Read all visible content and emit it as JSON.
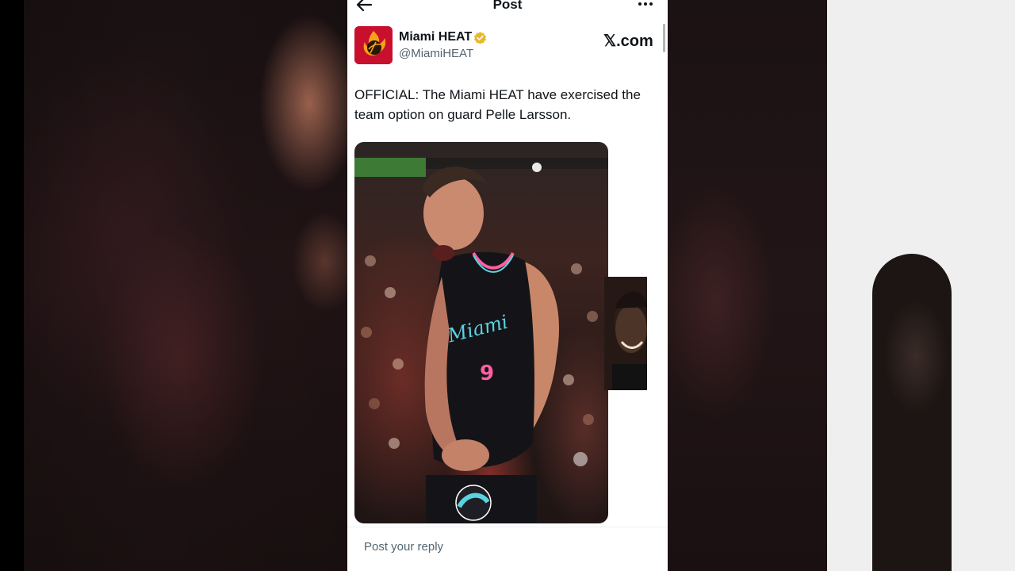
{
  "header": {
    "title": "Post"
  },
  "post": {
    "author_name": "Miami HEAT",
    "author_handle": "@MiamiHEAT",
    "source_label": "𝕏.com",
    "text": "OFFICIAL: The Miami HEAT have exercised the team option on guard Pelle Larsson."
  },
  "reply": {
    "placeholder": "Post your reply"
  },
  "colors": {
    "brand_red": "#c8102e",
    "verified_gold": "#e8b829",
    "text_primary": "#0f1419",
    "text_secondary": "#536471"
  },
  "icons": {
    "back": "arrow-left-icon",
    "more": "more-horizontal-icon",
    "verified": "verified-badge-icon",
    "avatar_logo": "heat-logo-icon"
  }
}
